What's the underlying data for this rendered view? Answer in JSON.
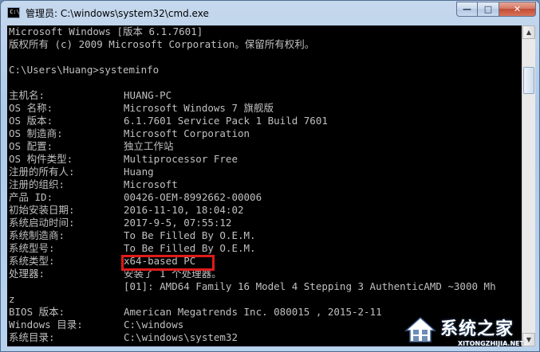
{
  "window": {
    "title": "管理员: C:\\windows\\system32\\cmd.exe",
    "icon_label": "C:\\",
    "buttons": {
      "minimize": "—",
      "maximize": "□",
      "close": "✕"
    }
  },
  "console": {
    "header": [
      "Microsoft Windows [版本 6.1.7601]",
      "版权所有 (c) 2009 Microsoft Corporation。保留所有权利。"
    ],
    "prompt": "C:\\Users\\Huang>systeminfo",
    "rows": [
      {
        "key": "主机名:",
        "value": "HUANG-PC"
      },
      {
        "key": "OS 名称:",
        "value": "Microsoft Windows 7 旗舰版"
      },
      {
        "key": "OS 版本:",
        "value": "6.1.7601 Service Pack 1 Build 7601"
      },
      {
        "key": "OS 制造商:",
        "value": "Microsoft Corporation"
      },
      {
        "key": "OS 配置:",
        "value": "独立工作站"
      },
      {
        "key": "OS 构件类型:",
        "value": "Multiprocessor Free"
      },
      {
        "key": "注册的所有人:",
        "value": "Huang"
      },
      {
        "key": "注册的组织:",
        "value": "Microsoft"
      },
      {
        "key": "产品 ID:",
        "value": "00426-OEM-8992662-00006"
      },
      {
        "key": "初始安装日期:",
        "value": "2016-11-10, 18:04:02"
      },
      {
        "key": "系统启动时间:",
        "value": "2017-9-5, 07:55:12"
      },
      {
        "key": "系统制造商:",
        "value": "To Be Filled By O.E.M."
      },
      {
        "key": "系统型号:",
        "value": "To Be Filled By O.E.M."
      },
      {
        "key": "系统类型:",
        "value": "x64-based PC"
      },
      {
        "key": "处理器:",
        "value": "安装了 1 个处理器。"
      },
      {
        "key": "",
        "value": "[01]: AMD64 Family 16 Model 4 Stepping 3 AuthenticAMD ~3000 Mh"
      },
      {
        "key": "z",
        "value": ""
      },
      {
        "key": "BIOS 版本:",
        "value": "American Megatrends Inc. 080015 , 2015-2-11"
      },
      {
        "key": "Windows 目录:",
        "value": "C:\\windows"
      },
      {
        "key": "系统目录:",
        "value": "C:\\windows\\system32"
      }
    ]
  },
  "scrollbar": {
    "up": "▲",
    "down": "▼"
  },
  "watermark": {
    "text": "系统之家",
    "url": "XITONGZHIJIA.NET"
  },
  "colors": {
    "console_text": "#c0c0c0",
    "console_bg": "#000000",
    "highlight": "#e01a1a"
  }
}
